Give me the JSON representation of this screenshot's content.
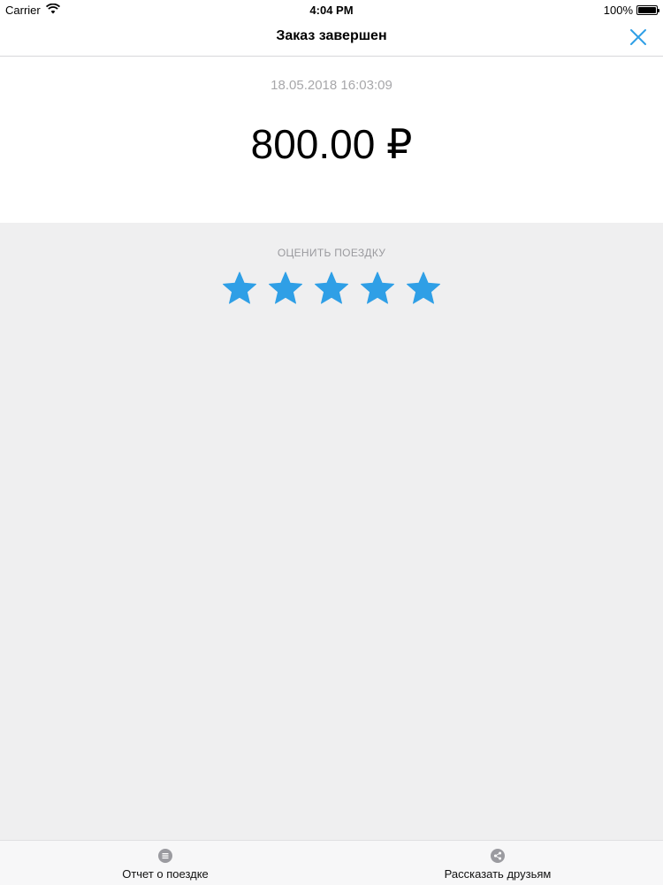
{
  "status_bar": {
    "carrier": "Carrier",
    "time": "4:04 PM",
    "battery": "100%"
  },
  "header": {
    "title": "Заказ завершен",
    "close_icon": "close-icon"
  },
  "order": {
    "datetime": "18.05.2018 16:03:09",
    "price": "800.00 ₽"
  },
  "rating": {
    "label": "ОЦЕНИТЬ ПОЕЗДКУ",
    "value": 5,
    "max": 5,
    "star_color": "#2f9fe6"
  },
  "tabs": [
    {
      "label": "Отчет о поездке",
      "icon": "list-icon"
    },
    {
      "label": "Рассказать друзьям",
      "icon": "share-icon"
    }
  ],
  "colors": {
    "accent": "#2f9fe6",
    "background": "#efeff0"
  }
}
